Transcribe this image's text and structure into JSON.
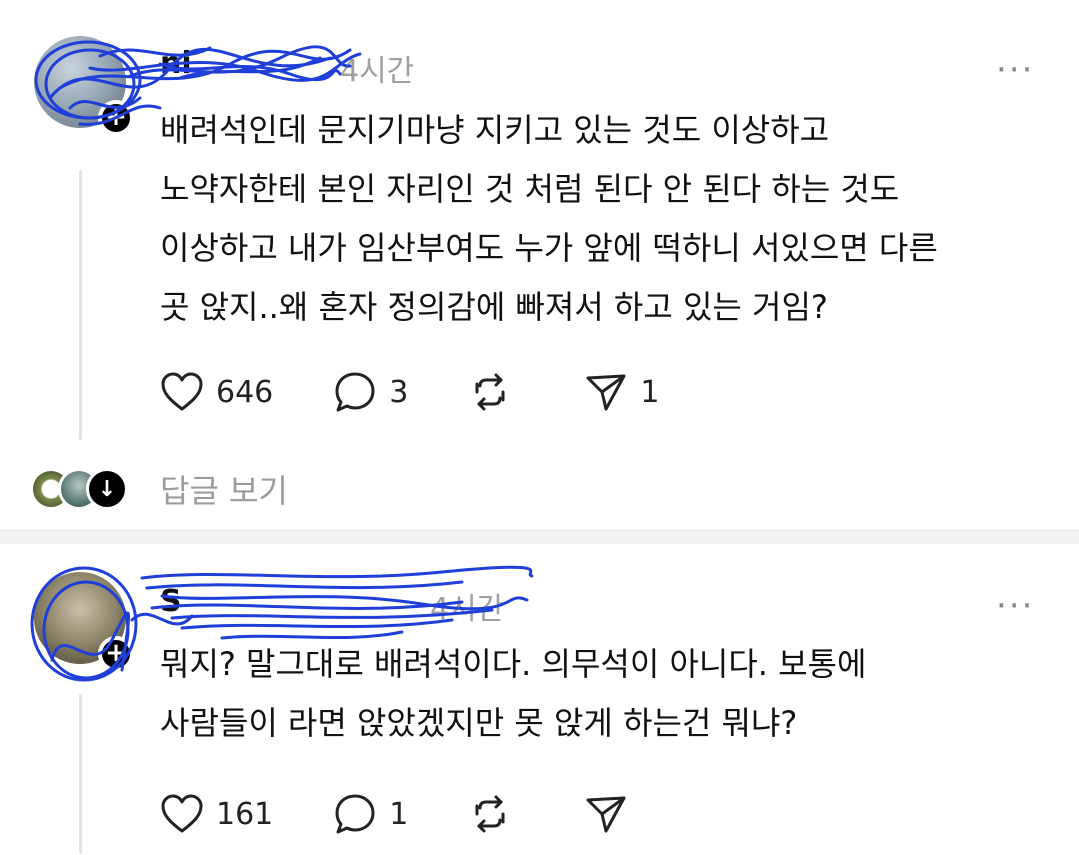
{
  "post1": {
    "username": "ni",
    "time": "4시간",
    "more": "···",
    "body": "배려석인데 문지기마냥 지키고 있는 것도 이상하고\n노약자한테 본인 자리인 것 처럼 된다 안 된다 하는 것도\n이상하고 내가 임산부여도 누가 앞에 떡하니 서있으면 다른\n곳 앉지..왜 혼자 정의감에 빠져서 하고 있는 거임?",
    "likes": "646",
    "comments": "3",
    "reposts": "",
    "shares": "1",
    "follow_icon": "+",
    "view_replies": "답글 보기",
    "down_icon": "↓"
  },
  "post2": {
    "username": "S",
    "time": "4시간",
    "more": "···",
    "body": "뭐지? 말그대로 배려석이다. 의무석이 아니다. 보통에\n사람들이 라면 앉았겠지만 못 앉게 하는건 뭐냐?",
    "likes": "161",
    "comments": "1",
    "reposts": "",
    "shares": "",
    "follow_icon": "+"
  },
  "colors": {
    "scribble": "#1f3fd8",
    "muted": "#9c9c9c",
    "divider": "#f3f3f3"
  },
  "icons": [
    "heart-icon",
    "comment-icon",
    "repost-icon",
    "share-icon",
    "more-icon",
    "plus-icon",
    "arrow-down-icon"
  ]
}
